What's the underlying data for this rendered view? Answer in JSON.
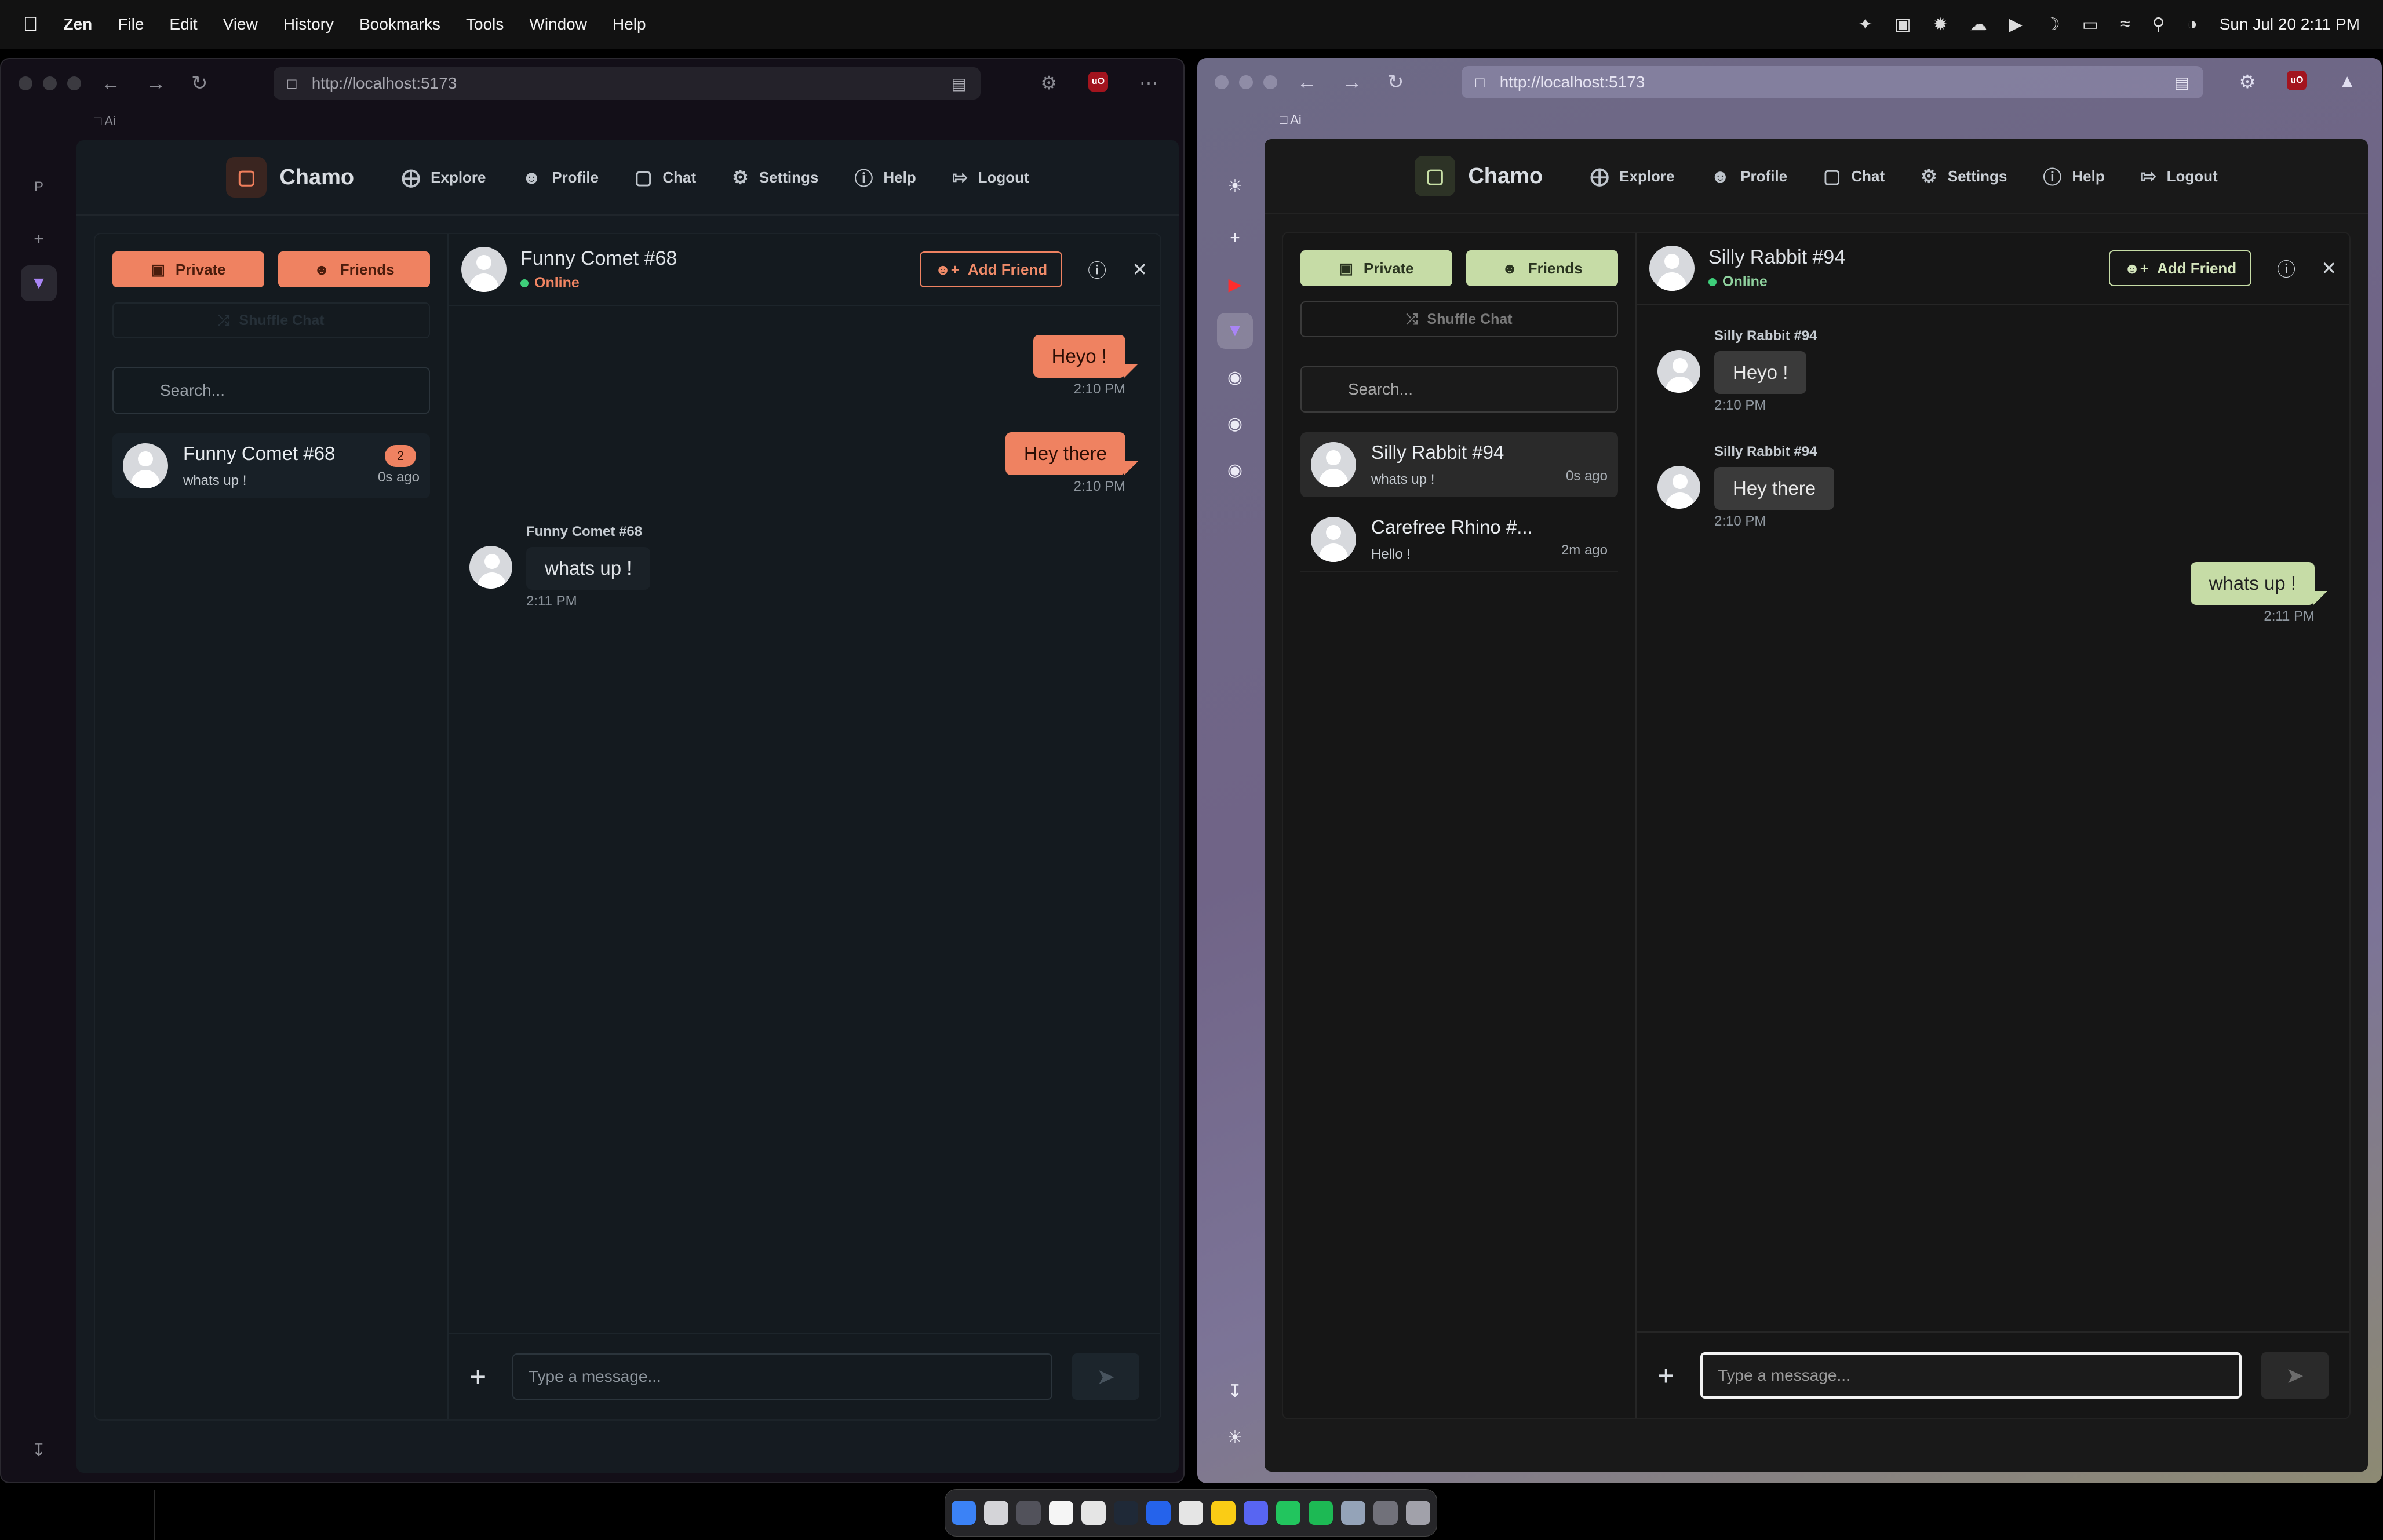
{
  "menubar": {
    "items": [
      "Zen",
      "File",
      "Edit",
      "View",
      "History",
      "Bookmarks",
      "Tools",
      "Window",
      "Help"
    ],
    "clock": "Sun Jul 20  2:11 PM"
  },
  "left_window": {
    "url": "http://localhost:5173",
    "workspace": "Ai",
    "workspace_letter": "P",
    "brand": "Chamo",
    "nav": [
      "Explore",
      "Profile",
      "Chat",
      "Settings",
      "Help",
      "Logout"
    ],
    "tabs": {
      "private": "Private",
      "friends": "Friends"
    },
    "shuffle": "Shuffle Chat",
    "search_placeholder": "Search...",
    "conversations": [
      {
        "name": "Funny Comet #68",
        "preview": "whats up !",
        "time": "0s ago",
        "badge": "2"
      }
    ],
    "chat": {
      "name": "Funny Comet #68",
      "status": "Online",
      "add_friend": "Add Friend",
      "messages": [
        {
          "dir": "out",
          "text": "Heyo !",
          "time": "2:10 PM"
        },
        {
          "dir": "out",
          "text": "Hey there",
          "time": "2:10 PM"
        },
        {
          "dir": "in",
          "sender": "Funny Comet #68",
          "text": "whats up !",
          "time": "2:11 PM"
        }
      ],
      "composer_placeholder": "Type a message..."
    },
    "accent": "#ef8261"
  },
  "right_window": {
    "url": "http://localhost:5173",
    "workspace": "Ai",
    "brand": "Chamo",
    "nav": [
      "Explore",
      "Profile",
      "Chat",
      "Settings",
      "Help",
      "Logout"
    ],
    "tabs": {
      "private": "Private",
      "friends": "Friends"
    },
    "shuffle": "Shuffle Chat",
    "search_placeholder": "Search...",
    "conversations": [
      {
        "name": "Silly Rabbit #94",
        "preview": "whats up !",
        "time": "0s ago"
      },
      {
        "name": "Carefree Rhino #...",
        "preview": "Hello !",
        "time": "2m ago"
      }
    ],
    "chat": {
      "name": "Silly Rabbit #94",
      "status": "Online",
      "add_friend": "Add Friend",
      "messages": [
        {
          "dir": "in",
          "sender": "Silly Rabbit #94",
          "text": "Heyo !",
          "time": "2:10 PM"
        },
        {
          "dir": "in",
          "sender": "Silly Rabbit #94",
          "text": "Hey there",
          "time": "2:10 PM"
        },
        {
          "dir": "out",
          "text": "whats up !",
          "time": "2:11 PM"
        }
      ],
      "composer_placeholder": "Type a message..."
    },
    "accent": "#c6dca6"
  }
}
